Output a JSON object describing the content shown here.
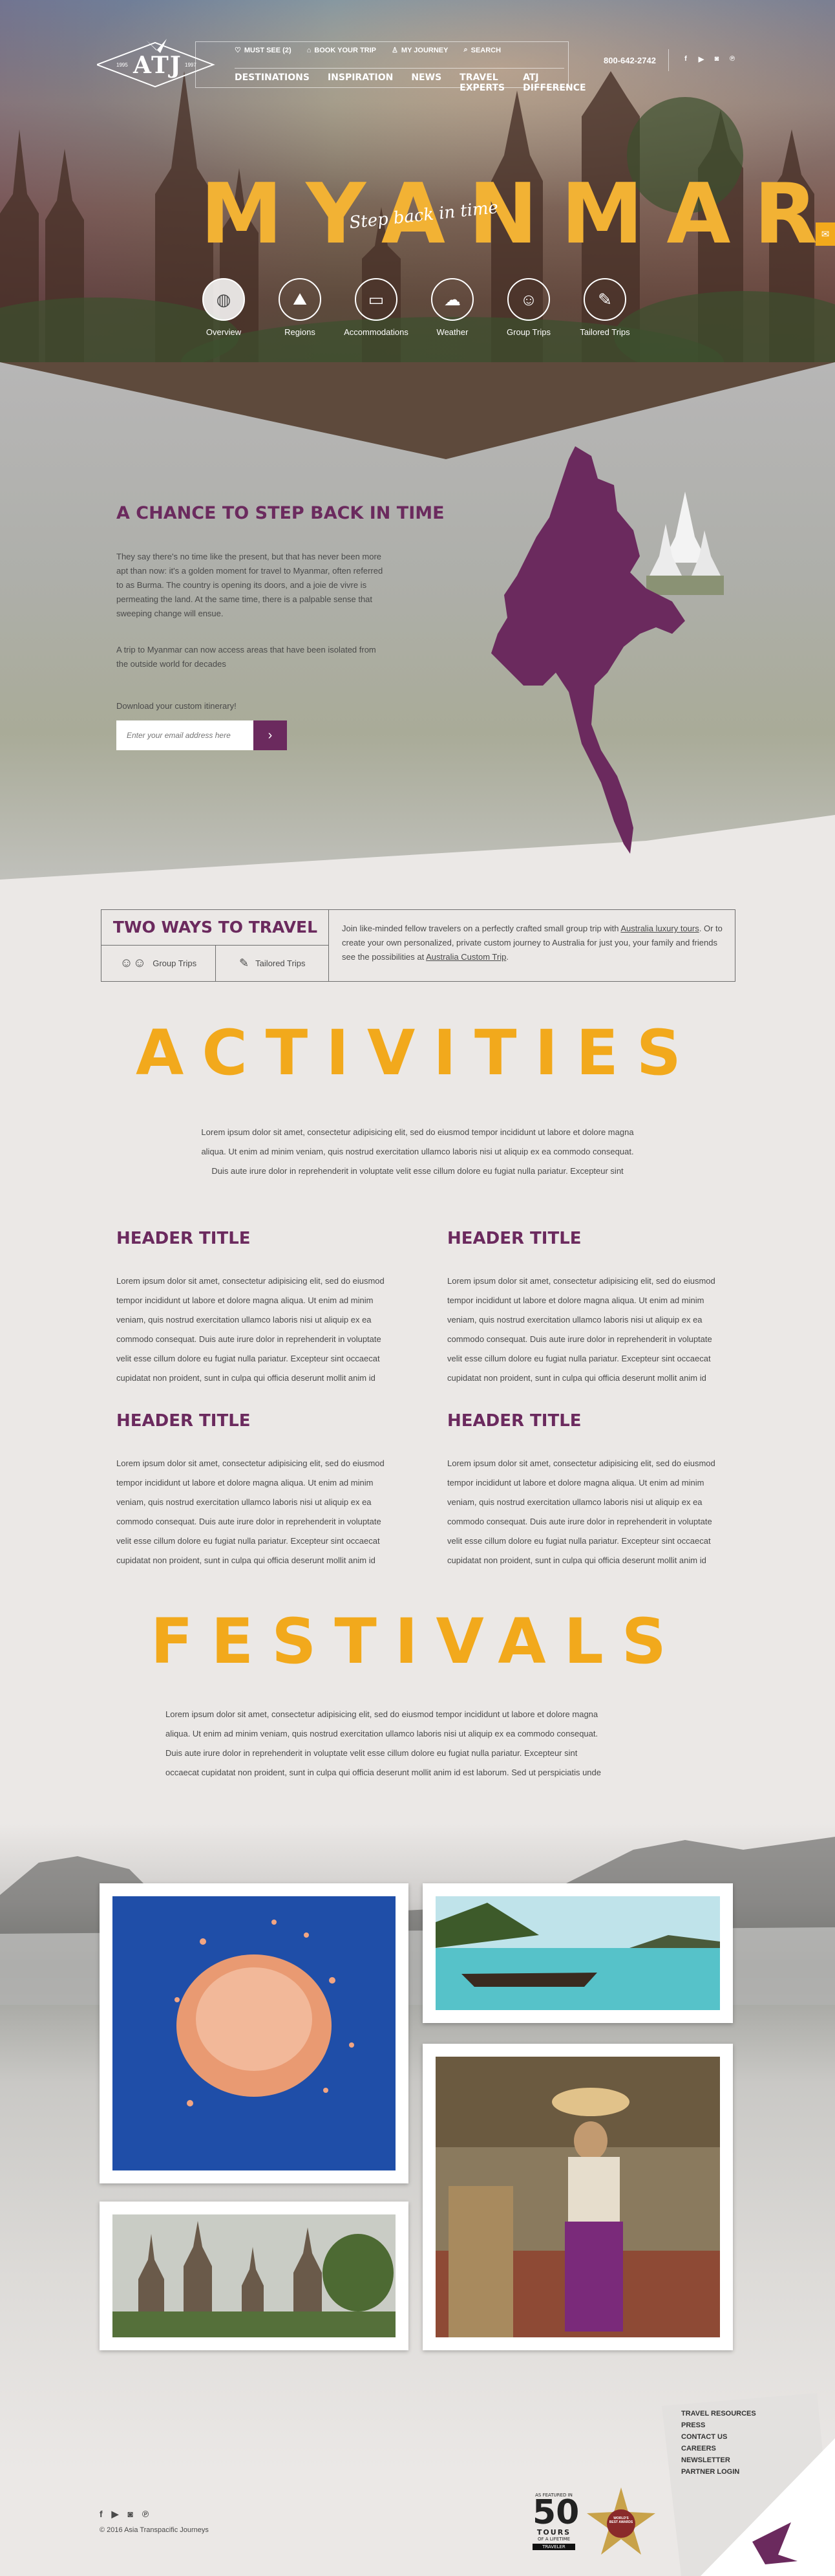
{
  "brand": {
    "logo_text": "ATJ",
    "logo_year_left": "1995",
    "logo_year_right": "1997"
  },
  "utility_nav": [
    {
      "label": "MUST SEE (2)",
      "icon": "heart-icon"
    },
    {
      "label": "BOOK YOUR TRIP",
      "icon": "tag-icon"
    },
    {
      "label": "MY JOURNEY",
      "icon": "person-icon"
    },
    {
      "label": "SEARCH",
      "icon": "search-icon"
    }
  ],
  "main_nav": [
    "DESTINATIONS",
    "INSPIRATION",
    "NEWS",
    "TRAVEL EXPERTS",
    "ATJ DIFFERENCE"
  ],
  "phone": "800-642-2742",
  "hero": {
    "title": "MYANMAR",
    "tagline": "Step back in time",
    "tabs": [
      {
        "label": "Overview",
        "icon": "globe-icon",
        "active": true
      },
      {
        "label": "Regions",
        "icon": "mountains-icon",
        "active": false
      },
      {
        "label": "Accommodations",
        "icon": "bed-icon",
        "active": false
      },
      {
        "label": "Weather",
        "icon": "weather-icon",
        "active": false
      },
      {
        "label": "Group Trips",
        "icon": "group-icon",
        "active": false
      },
      {
        "label": "Tailored Trips",
        "icon": "tailored-icon",
        "active": false
      }
    ]
  },
  "intro": {
    "title": "A CHANCE TO STEP BACK IN TIME",
    "paragraph_1": "They say there's no time like the present, but that has never been more apt than now: it's a golden moment for travel to Myanmar, often referred to as Burma. The country is opening its doors, and a joie de vivre is permeating the land. At the same time,  there is a palpable sense that sweeping change will ensue.",
    "paragraph_2": "A trip to Myanmar can now access areas that have been isolated from the outside world for decades",
    "download_label": "Download your custom itinerary!",
    "email_placeholder": "Enter your email address here"
  },
  "two_ways": {
    "title": "TWO WAYS TO TRAVEL",
    "option_group": "Group Trips",
    "option_tailored": "Tailored Trips",
    "text_1": "Join like-minded fellow travelers on a perfectly crafted small group trip with ",
    "link_1": "Australia luxury tours",
    "text_2": ". Or to create your own personalized, private custom journey to Australia for just you, your family and friends see the possibilities at ",
    "link_2": "Australia Custom Trip",
    "text_3": "."
  },
  "activities": {
    "title": "ACTIVITIES",
    "intro_lines": [
      "Lorem ipsum dolor sit amet, consectetur adipisicing elit, sed do eiusmod tempor incididunt ut labore et dolore magna",
      "aliqua. Ut enim ad minim veniam, quis nostrud exercitation ullamco laboris nisi ut aliquip ex ea commodo consequat.",
      "Duis aute irure dolor in reprehenderit in voluptate velit esse cillum dolore eu fugiat nulla pariatur. Excepteur sint"
    ],
    "items": [
      {
        "header": "HEADER TITLE",
        "text": "Lorem ipsum dolor sit amet, consectetur adipisicing elit, sed do eiusmod tempor incididunt ut labore et dolore magna aliqua. Ut enim ad minim veniam, quis nostrud exercitation ullamco laboris nisi ut aliquip ex ea commodo consequat. Duis aute irure dolor in reprehenderit in voluptate velit esse cillum dolore eu fugiat nulla pariatur. Excepteur sint occaecat cupidatat non proident, sunt in culpa qui officia deserunt mollit anim id"
      },
      {
        "header": "HEADER TITLE",
        "text": "Lorem ipsum dolor sit amet, consectetur adipisicing elit, sed do eiusmod tempor incididunt ut labore et dolore magna aliqua. Ut enim ad minim veniam, quis nostrud exercitation ullamco laboris nisi ut aliquip ex ea commodo consequat. Duis aute irure dolor in reprehenderit in voluptate velit esse cillum dolore eu fugiat nulla pariatur. Excepteur sint occaecat cupidatat non proident, sunt in culpa qui officia deserunt mollit anim id"
      },
      {
        "header": "HEADER TITLE",
        "text": "Lorem ipsum dolor sit amet, consectetur adipisicing elit, sed do eiusmod tempor incididunt ut labore et dolore magna aliqua. Ut enim ad minim veniam, quis nostrud exercitation ullamco laboris nisi ut aliquip ex ea commodo consequat. Duis aute irure dolor in reprehenderit in voluptate velit esse cillum dolore eu fugiat nulla pariatur. Excepteur sint occaecat cupidatat non proident, sunt in culpa qui officia deserunt mollit anim id"
      },
      {
        "header": "HEADER TITLE",
        "text": "Lorem ipsum dolor sit amet, consectetur adipisicing elit, sed do eiusmod tempor incididunt ut labore et dolore magna aliqua. Ut enim ad minim veniam, quis nostrud exercitation ullamco laboris nisi ut aliquip ex ea commodo consequat. Duis aute irure dolor in reprehenderit in voluptate velit esse cillum dolore eu fugiat nulla pariatur. Excepteur sint occaecat cupidatat non proident, sunt in culpa qui officia deserunt mollit anim id"
      }
    ]
  },
  "festivals": {
    "title": "FESTIVALS",
    "intro_lines": [
      "Lorem ipsum dolor sit amet, consectetur adipisicing elit, sed do eiusmod tempor incididunt ut labore et dolore magna",
      "aliqua. Ut enim ad minim veniam, quis nostrud exercitation ullamco laboris nisi ut aliquip ex ea commodo consequat.",
      "Duis aute irure dolor in reprehenderit in voluptate velit esse cillum dolore eu fugiat nulla pariatur. Excepteur sint",
      "occaecat cupidatat non proident, sunt in culpa qui officia deserunt mollit anim id est laborum. Sed ut perspiciatis unde"
    ]
  },
  "footer": {
    "links": [
      "TRAVEL RESOURCES",
      "PRESS",
      "CONTACT US",
      "CAREERS",
      "NEWSLETTER",
      "PARTNER LOGIN"
    ],
    "copyright": "© 2016 Asia Transpacific Journeys",
    "award_50": {
      "top": "AS FEATURED IN",
      "number": "50",
      "label": "TOURS",
      "sub": "OF A LIFETIME",
      "brand": "TRAVELER"
    },
    "award_wba": "WORLD'S BEST AWARDS"
  },
  "colors": {
    "purple": "#6b2a5e",
    "gold": "#f2a91c",
    "background": "#ebe8e6"
  }
}
